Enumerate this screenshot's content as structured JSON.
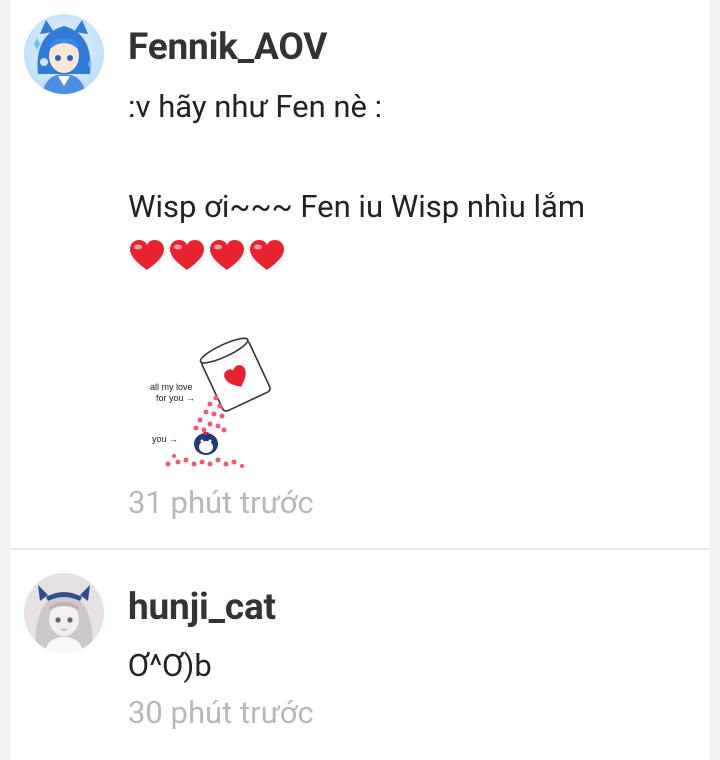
{
  "comments": [
    {
      "username": "Fennik_AOV",
      "line1": ":v hãy như Fen nè :",
      "line2": "Wisp ơi~~~ Fen iu Wisp nhìu lắm",
      "hearts_count": 4,
      "sticker": {
        "label": "all my love for you →",
        "label_line1": "all my love",
        "label_line2": "for you →",
        "you_label": "you →"
      },
      "timestamp": "31 phút trước"
    },
    {
      "username": "hunji_cat",
      "text": "Ơ^Ơ)b",
      "timestamp": "30 phút trước"
    }
  ],
  "colors": {
    "heart": "#e8232f",
    "username": "#333333",
    "timestamp": "#b8b8b8"
  }
}
